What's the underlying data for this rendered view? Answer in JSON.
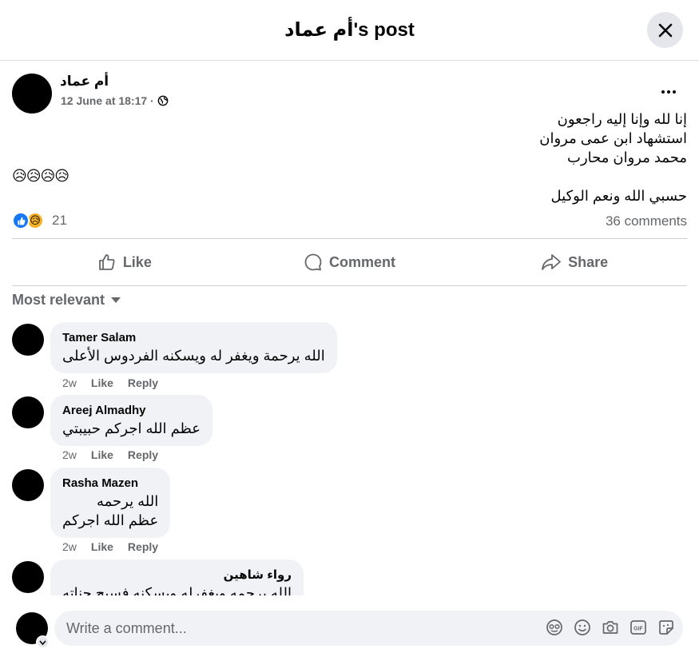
{
  "header": {
    "title": "أم عماد's post"
  },
  "post": {
    "author": "أم عماد",
    "date": "12 June at 18:17 ·",
    "lines": [
      "إنا لله وإنا إليه راجعون",
      "استشهاد ابن عمى مروان",
      "محمد مروان محارب"
    ],
    "emoji": "😥😥😥😥",
    "last_line": "حسبي الله ونعم الوكيل",
    "reaction_count": "21",
    "comments_count": "36 comments"
  },
  "actions": {
    "like": "Like",
    "comment": "Comment",
    "share": "Share"
  },
  "sort_label": "Most relevant",
  "comments": [
    {
      "name": "Tamer Salam",
      "lines": [
        "الله يرحمة ويغفر له ويسكنه الفردوس الأعلى"
      ],
      "time": "2w",
      "like": "Like",
      "reply": "Reply"
    },
    {
      "name": "Areej Almadhy",
      "lines": [
        "عظم الله اجركم حبيبتي"
      ],
      "time": "2w",
      "like": "Like",
      "reply": "Reply"
    },
    {
      "name": "Rasha Mazen",
      "lines": [
        "الله يرحمه",
        "عظم الله اجركم"
      ],
      "time": "2w",
      "like": "Like",
      "reply": "Reply"
    },
    {
      "name": "رواء شاهين",
      "lines": [
        "الله يرحمه ويغفرله ويسكنه فسيح جناته"
      ]
    }
  ],
  "composer": {
    "placeholder": "Write a comment..."
  },
  "colors": {
    "accent": "#1877f2",
    "secondary_text": "#65676b",
    "bubble": "#f0f2f5"
  }
}
